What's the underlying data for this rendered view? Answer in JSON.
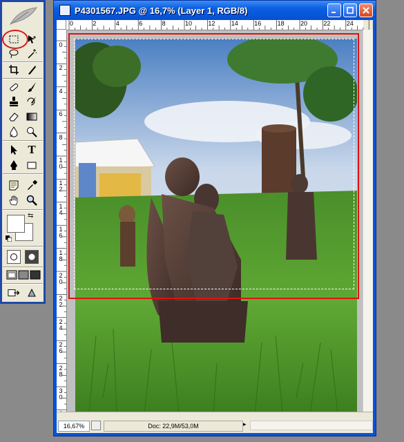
{
  "window": {
    "title": "P4301567.JPG @ 16,7% (Layer 1, RGB/8)"
  },
  "ruler": {
    "h_labels": [
      "0",
      "2",
      "4",
      "6",
      "8",
      "10",
      "12",
      "14",
      "16",
      "18",
      "20",
      "22",
      "24"
    ],
    "v_labels": [
      "0",
      "2",
      "4",
      "6",
      "8",
      "1\n0",
      "1\n2",
      "1\n4",
      "1\n6",
      "1\n8",
      "2\n0",
      "2\n2",
      "2\n4",
      "2\n6",
      "2\n8",
      "3\n0",
      "3\n2"
    ]
  },
  "status": {
    "zoom": "16,67%",
    "doc_size": "Doc: 22,9M/53,0M"
  },
  "toolbox": {
    "tools": [
      {
        "name": "marquee-tool-icon",
        "selected": true
      },
      {
        "name": "move-tool-icon"
      },
      {
        "name": "lasso-tool-icon"
      },
      {
        "name": "magic-wand-tool-icon"
      },
      {
        "name": "crop-tool-icon"
      },
      {
        "name": "slice-tool-icon"
      },
      {
        "name": "healing-brush-tool-icon"
      },
      {
        "name": "brush-tool-icon"
      },
      {
        "name": "clone-stamp-tool-icon"
      },
      {
        "name": "history-brush-tool-icon"
      },
      {
        "name": "eraser-tool-icon"
      },
      {
        "name": "gradient-tool-icon"
      },
      {
        "name": "blur-tool-icon"
      },
      {
        "name": "dodge-tool-icon"
      },
      {
        "name": "path-selection-tool-icon"
      },
      {
        "name": "type-tool-icon"
      },
      {
        "name": "pen-tool-icon"
      },
      {
        "name": "shape-tool-icon"
      },
      {
        "name": "notes-tool-icon"
      },
      {
        "name": "eyedropper-tool-icon"
      },
      {
        "name": "hand-tool-icon"
      },
      {
        "name": "zoom-tool-icon"
      }
    ],
    "type_glyph": "T"
  },
  "colors": {
    "highlight": "#e01010",
    "title_bar": "#0a5fe0",
    "foreground": "#ffffff",
    "background": "#ffffff"
  }
}
